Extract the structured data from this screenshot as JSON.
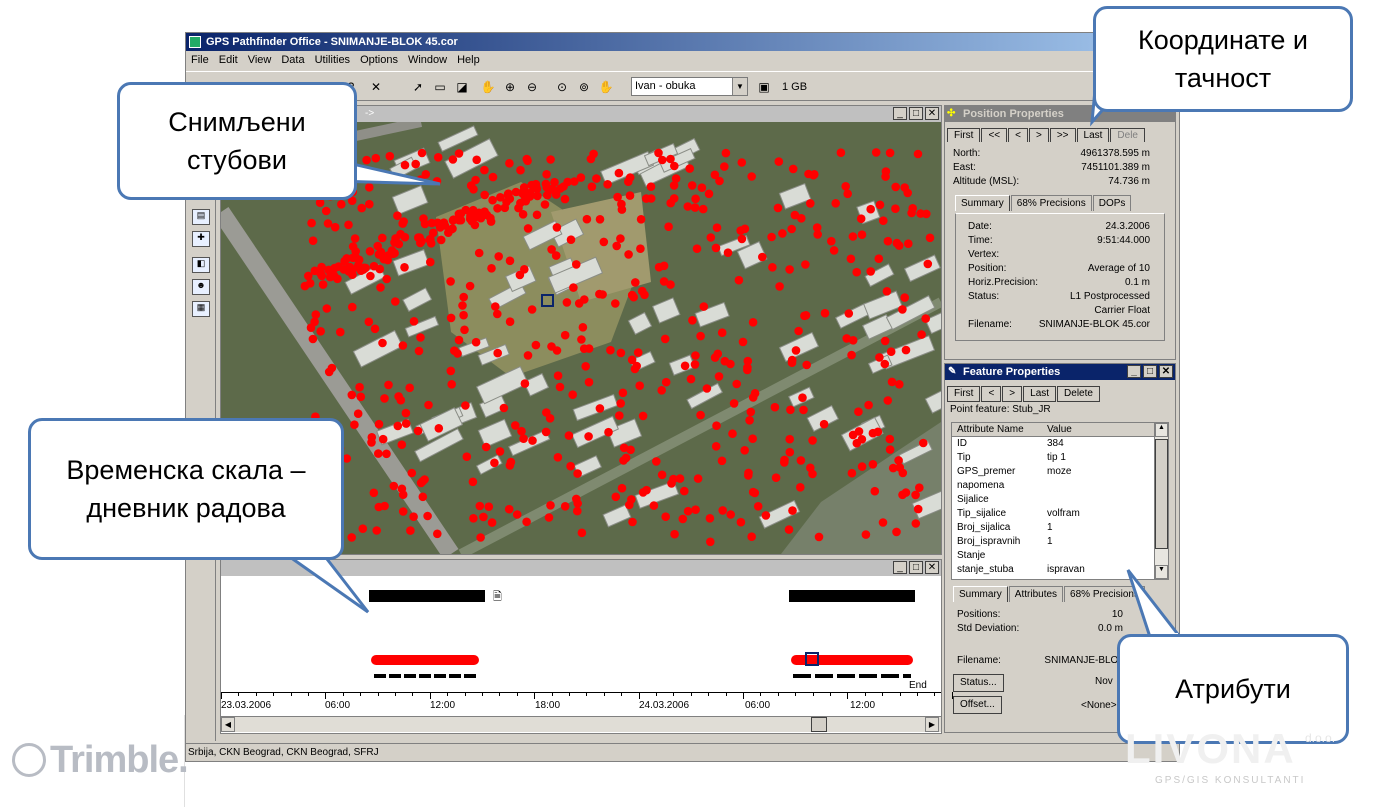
{
  "app": {
    "title": "GPS Pathfinder Office - SNIMANJE-BLOK 45.cor",
    "menu": [
      "File",
      "Edit",
      "View",
      "Data",
      "Utilities",
      "Options",
      "Window",
      "Help"
    ],
    "combo_value": "Ivan - obuka",
    "size_label": "1 GB",
    "status_text": "Srbija, CKN Beograd, CKN Beograd, SFRJ"
  },
  "map_window": {
    "title": "->"
  },
  "position_properties": {
    "title": "Position Properties",
    "nav": [
      "First",
      "<<",
      "<",
      ">",
      ">>",
      "Last",
      "Dele"
    ],
    "coords": [
      {
        "k": "North:",
        "v": "4961378.595 m"
      },
      {
        "k": "East:",
        "v": "7451101.389 m"
      },
      {
        "k": "Altitude (MSL):",
        "v": "74.736 m"
      }
    ],
    "tabs": [
      "Summary",
      "68% Precisions",
      "DOPs"
    ],
    "summary": [
      {
        "k": "Date:",
        "v": "24.3.2006"
      },
      {
        "k": "Time:",
        "v": "9:51:44.000"
      },
      {
        "k": "Vertex:",
        "v": ""
      },
      {
        "k": "Position:",
        "v": "Average of 10"
      },
      {
        "k": "Horiz.Precision:",
        "v": "0.1 m"
      },
      {
        "k": "Status:",
        "v": "L1 Postprocessed"
      },
      {
        "k": "",
        "v": "Carrier Float"
      },
      {
        "k": "Filename:",
        "v": "SNIMANJE-BLOK 45.cor"
      }
    ]
  },
  "feature_properties": {
    "title": "Feature Properties",
    "nav": [
      "First",
      "<",
      ">",
      "Last",
      "Delete"
    ],
    "feature_label": "Point feature: Stub_JR",
    "headers": [
      "Attribute Name",
      "Value"
    ],
    "rows": [
      {
        "k": "ID",
        "v": "384"
      },
      {
        "k": "Tip",
        "v": "tip 1"
      },
      {
        "k": "GPS_premer",
        "v": "moze"
      },
      {
        "k": "napomena",
        "v": ""
      },
      {
        "k": "Sijalice",
        "v": ""
      },
      {
        "k": "Tip_sijalice",
        "v": "volfram"
      },
      {
        "k": "Broj_sijalica",
        "v": "1"
      },
      {
        "k": "Broj_ispravnih",
        "v": "1"
      },
      {
        "k": "Stanje",
        "v": ""
      },
      {
        "k": "stanje_stuba",
        "v": "ispravan"
      }
    ],
    "tabs": [
      "Summary",
      "Attributes",
      "68% Precisions"
    ],
    "summary": [
      {
        "k": "Positions:",
        "v": "10"
      },
      {
        "k": "Std Deviation:",
        "v": "0.0 m"
      }
    ],
    "filename_label": "Filename:",
    "filename_value": "SNIMANJE-BLOK",
    "status_button": "Status...",
    "status_value": "Nov",
    "offset_button": "Offset...",
    "offset_value": "<None>"
  },
  "timeline": {
    "ticks": [
      "23.03.2006",
      "06:00",
      "12:00",
      "18:00",
      "24.03.2006",
      "06:00",
      "12:00"
    ],
    "end_label": "End"
  },
  "callouts": {
    "poles": "Снимљени стубови",
    "coords": "Координате и тачност",
    "timeline": "Временска скала – дневник радова",
    "attributes": "Атрибути"
  },
  "logos": {
    "trimble": "Trimble.",
    "livona": "LIVONA",
    "livona_sub": "GPS/GIS KONSULTANTI",
    "livona_doo": "d.o.o."
  },
  "colors": {
    "accent": "#4b78b4",
    "marker": "#ff0000",
    "titlebar": "#0a246a"
  }
}
